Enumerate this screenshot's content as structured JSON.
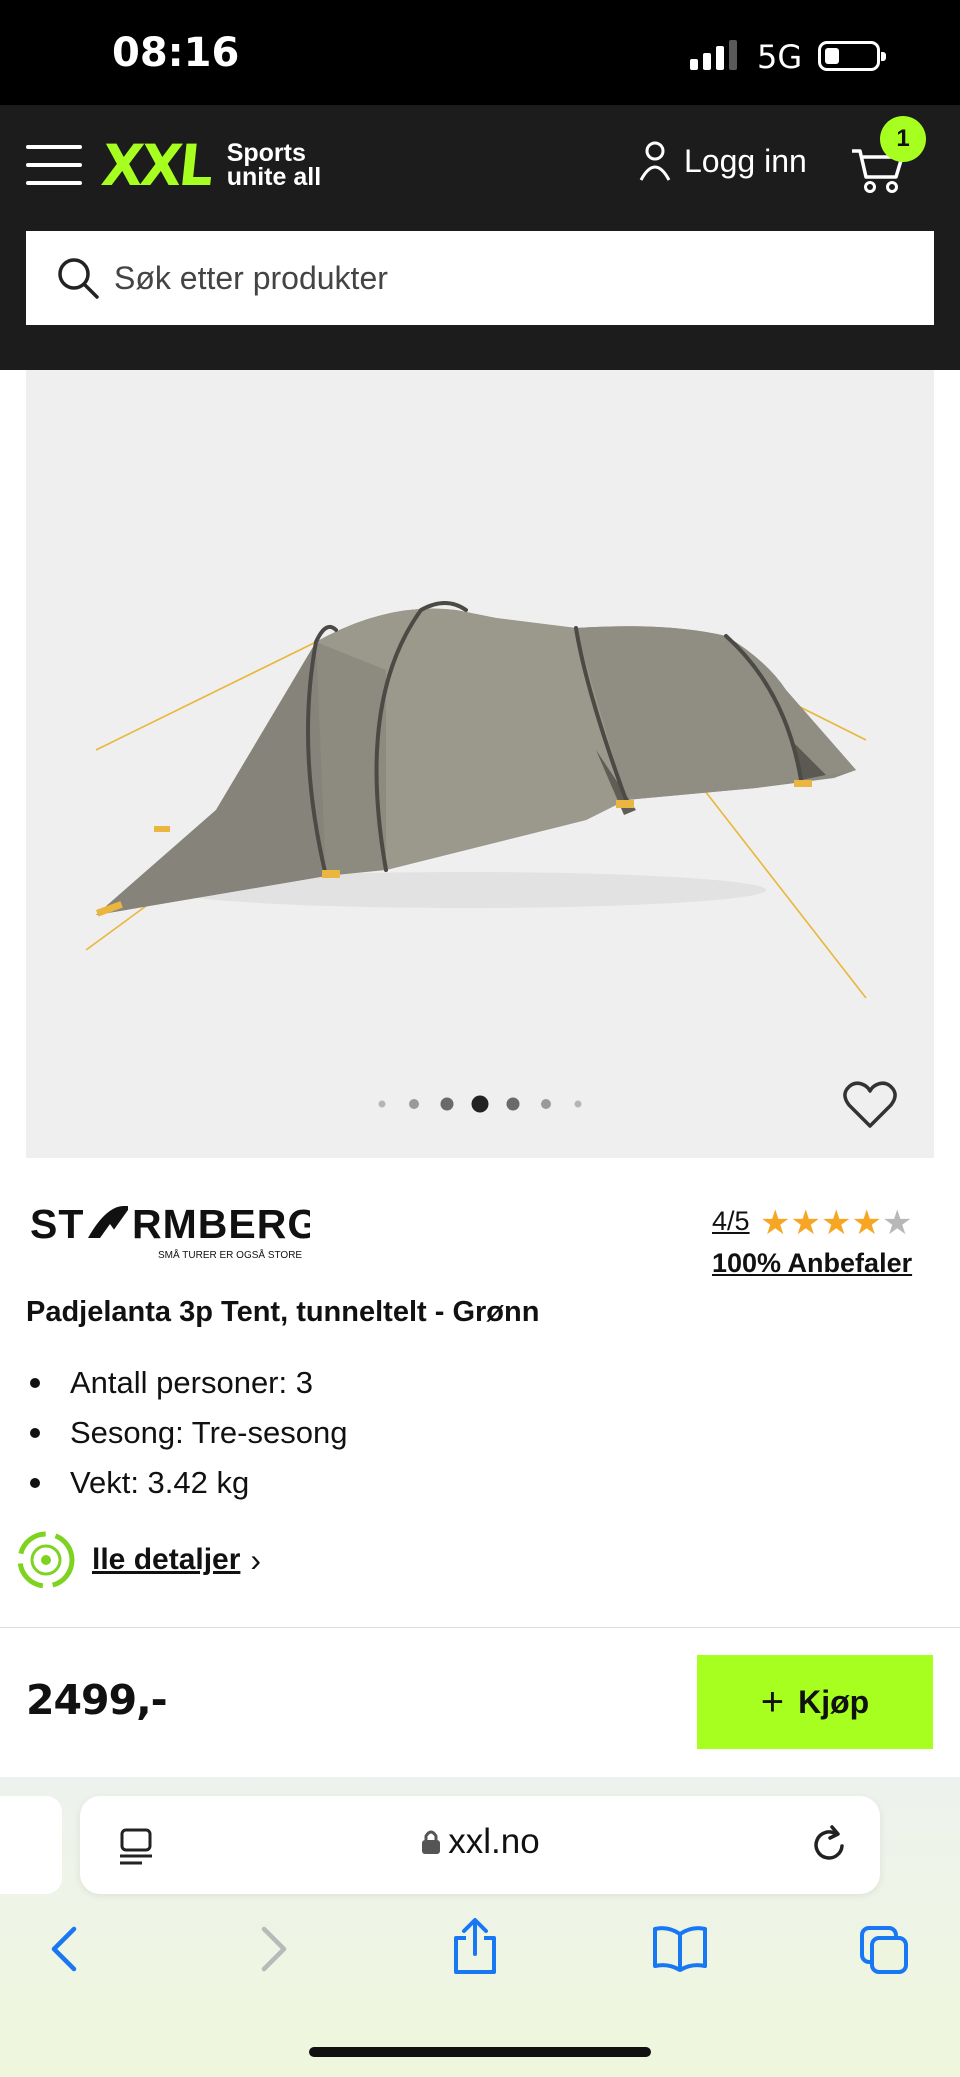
{
  "status_bar": {
    "time": "08:16",
    "network": "5G",
    "signal_bars_filled": 3,
    "battery_level": 0.2
  },
  "header": {
    "logo_text": "XXL",
    "logo_tagline_line1": "Sports",
    "logo_tagline_line2": "unite all",
    "login_label": "Logg inn",
    "cart_count": "1",
    "search_placeholder": "Søk etter produkter",
    "accent_color": "#a6ff1e",
    "background_color": "#1c1c1c"
  },
  "gallery": {
    "image_alt": "Tunnel tent, green",
    "slide_count": 7,
    "active_slide": 4
  },
  "product": {
    "brand_name": "STORMBERG",
    "brand_slogan": "SMÅ TURER ER OGSÅ STORE",
    "rating_text": "4/5",
    "rating_value": 4,
    "rating_max": 5,
    "recommend_text": "100% Anbefaler",
    "title": "Padjelanta 3p Tent, tunneltelt - Grønn",
    "specs": [
      "Antall personer: 3",
      "Sesong: Tre-sesong",
      "Vekt: 3.42 kg"
    ],
    "details_link": "lle detaljer",
    "price": "2499,-",
    "buy_label": "Kjøp"
  },
  "browser": {
    "url": "xxl.no"
  }
}
